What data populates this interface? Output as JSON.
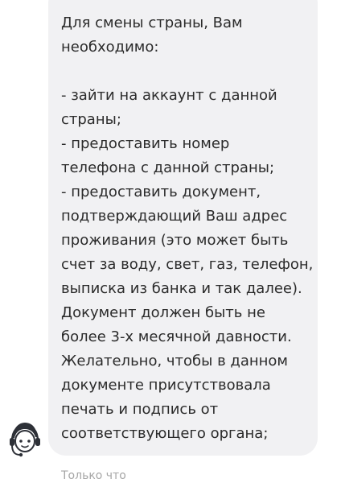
{
  "message": {
    "lines": [
      "Для смены страны, Вам",
      "необходимо:",
      "",
      "- зайти на аккаунт с данной",
      "страны;",
      "- предоставить номер",
      "телефона с данной страны;",
      "- предоставить документ,",
      "подтверждающий Ваш адрес",
      "проживания (это может быть",
      "счет за воду, свет, газ, телефон,",
      "выписка из банка и так далее).",
      "Документ должен быть не",
      "более 3-х месячной давности.",
      "Желательно, чтобы в данном",
      "документе присутствовала",
      "печать и подпись от",
      "соответствующего органа;"
    ],
    "timestamp": "Только что"
  },
  "avatar": {
    "icon": "support-agent-icon"
  },
  "colors": {
    "bubble": "#f1f1f3",
    "text": "#2b2b2b",
    "timestamp": "#a6a6a6"
  }
}
